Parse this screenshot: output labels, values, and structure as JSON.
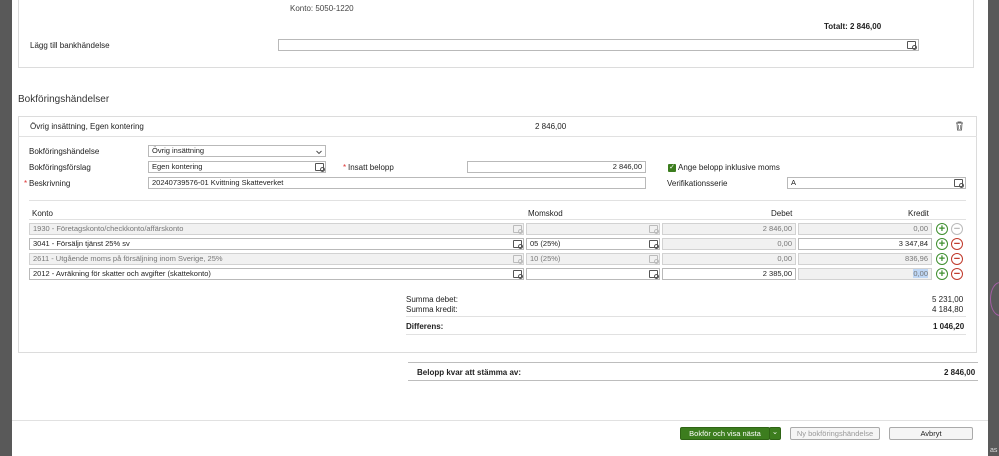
{
  "top": {
    "account_line": "Konto: 5050-1220",
    "total_label": "Totalt:",
    "total_value": "2 846,00",
    "add_bank_label": "Lägg till bankhändelse",
    "add_bank_value": ""
  },
  "section_title": "Bokföringshändelser",
  "event": {
    "header_label": "Övrig insättning, Egen kontering",
    "header_amount": "2 846,00",
    "bokforingshandelse_label": "Bokföringshändelse",
    "bokforingshandelse_value": "Övrig insättning",
    "bokforingsforslag_label": "Bokföringsförslag",
    "bokforingsforslag_value": "Egen kontering",
    "insatt_belopp_label": "Insatt belopp",
    "insatt_belopp_value": "2 846,00",
    "inkl_moms_label": "Ange belopp inklusive moms",
    "beskrivning_label": "Beskrivning",
    "beskrivning_value": "20240739576-01 Kvittning Skatteverket",
    "verifikationsserie_label": "Verifikationsserie",
    "verifikationsserie_value": "A",
    "required_mark": "*",
    "check_mark": "✓"
  },
  "table": {
    "headers": {
      "konto": "Konto",
      "momskod": "Momskod",
      "debet": "Debet",
      "kredit": "Kredit"
    },
    "rows": [
      {
        "konto": "1930 - Företagskonto/checkkonto/affärskonto",
        "momskod": "",
        "debet": "2 846,00",
        "kredit": "0,00",
        "disabled": true
      },
      {
        "konto": "3041 - Försäljn tjänst 25% sv",
        "momskod": "05 (25%)",
        "debet": "0,00",
        "kredit": "3 347,84",
        "disabled": false
      },
      {
        "konto": "2611 - Utgående moms på försäljning inom Sverige, 25%",
        "momskod": "10 (25%)",
        "debet": "0,00",
        "kredit": "836,96",
        "disabled": true
      },
      {
        "konto": "2012 - Avräkning för skatter och avgifter (skattekonto)",
        "momskod": "",
        "debet": "2 385,00",
        "kredit": "0,00",
        "disabled": false
      }
    ],
    "add_symbol": "+",
    "remove_symbol": "−"
  },
  "summary": {
    "summa_debet_label": "Summa debet:",
    "summa_debet_value": "5 231,00",
    "summa_kredit_label": "Summa kredit:",
    "summa_kredit_value": "4 184,80",
    "differens_label": "Differens:",
    "differens_value": "1 046,20"
  },
  "remaining": {
    "label": "Belopp kvar att stämma av:",
    "value": "2 846,00"
  },
  "footer": {
    "primary_label": "Bokför och visa nästa",
    "dropdown_glyph": "⌄",
    "new_event_label": "Ny bokföringshändelse",
    "cancel_label": "Avbryt"
  },
  "side": {
    "fragment": "as"
  },
  "colors": {
    "primary": "#3c7d1e",
    "add": "#3f8f2f",
    "remove": "#c0392b"
  }
}
